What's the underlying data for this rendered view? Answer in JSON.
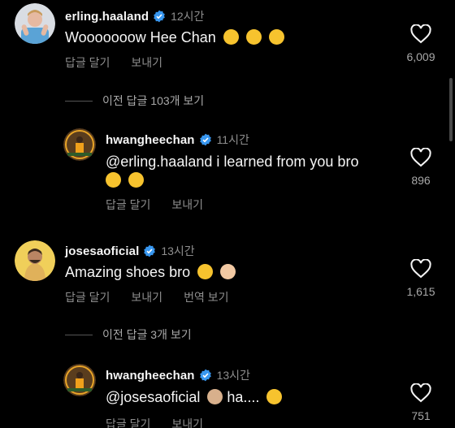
{
  "comments": [
    {
      "username": "erling.haaland",
      "time": "12시간",
      "text": "Wooooooow Hee Chan",
      "emojis": [
        "relieved-face",
        "relieved-face",
        "grinning-squinting-face"
      ],
      "actions": [
        "답글 달기",
        "보내기"
      ],
      "likes": "6,009"
    },
    {
      "view_previous": "이전 답글 103개 보기"
    },
    {
      "username": "hwangheechan",
      "time": "11시간",
      "text_line1": "@erling.haaland i learned from you bro",
      "emojis": [
        "rolling-laughing-face",
        "heart-eyes-face"
      ],
      "actions": [
        "답글 달기",
        "보내기"
      ],
      "likes": "896"
    },
    {
      "username": "josesaoficial",
      "time": "13시간",
      "text": "Amazing shoes bro",
      "emojis": [
        "tears-of-joy-face",
        "clapping-hands"
      ],
      "actions": [
        "답글 달기",
        "보내기",
        "번역 보기"
      ],
      "likes": "1,615"
    },
    {
      "view_previous": "이전 답글 3개 보기"
    },
    {
      "username": "hwangheechan",
      "time": "13시간",
      "text": "@josesaoficial",
      "text_after": "ha....",
      "emojis": [
        "man-facepalming",
        "tears-of-joy-face"
      ],
      "actions": [
        "답글 달기",
        "보내기"
      ],
      "likes": "751"
    }
  ],
  "colors": {
    "background": "#000000",
    "text": "#f5f5f5",
    "muted": "#8e8e8e",
    "verified": "#3897f0"
  }
}
